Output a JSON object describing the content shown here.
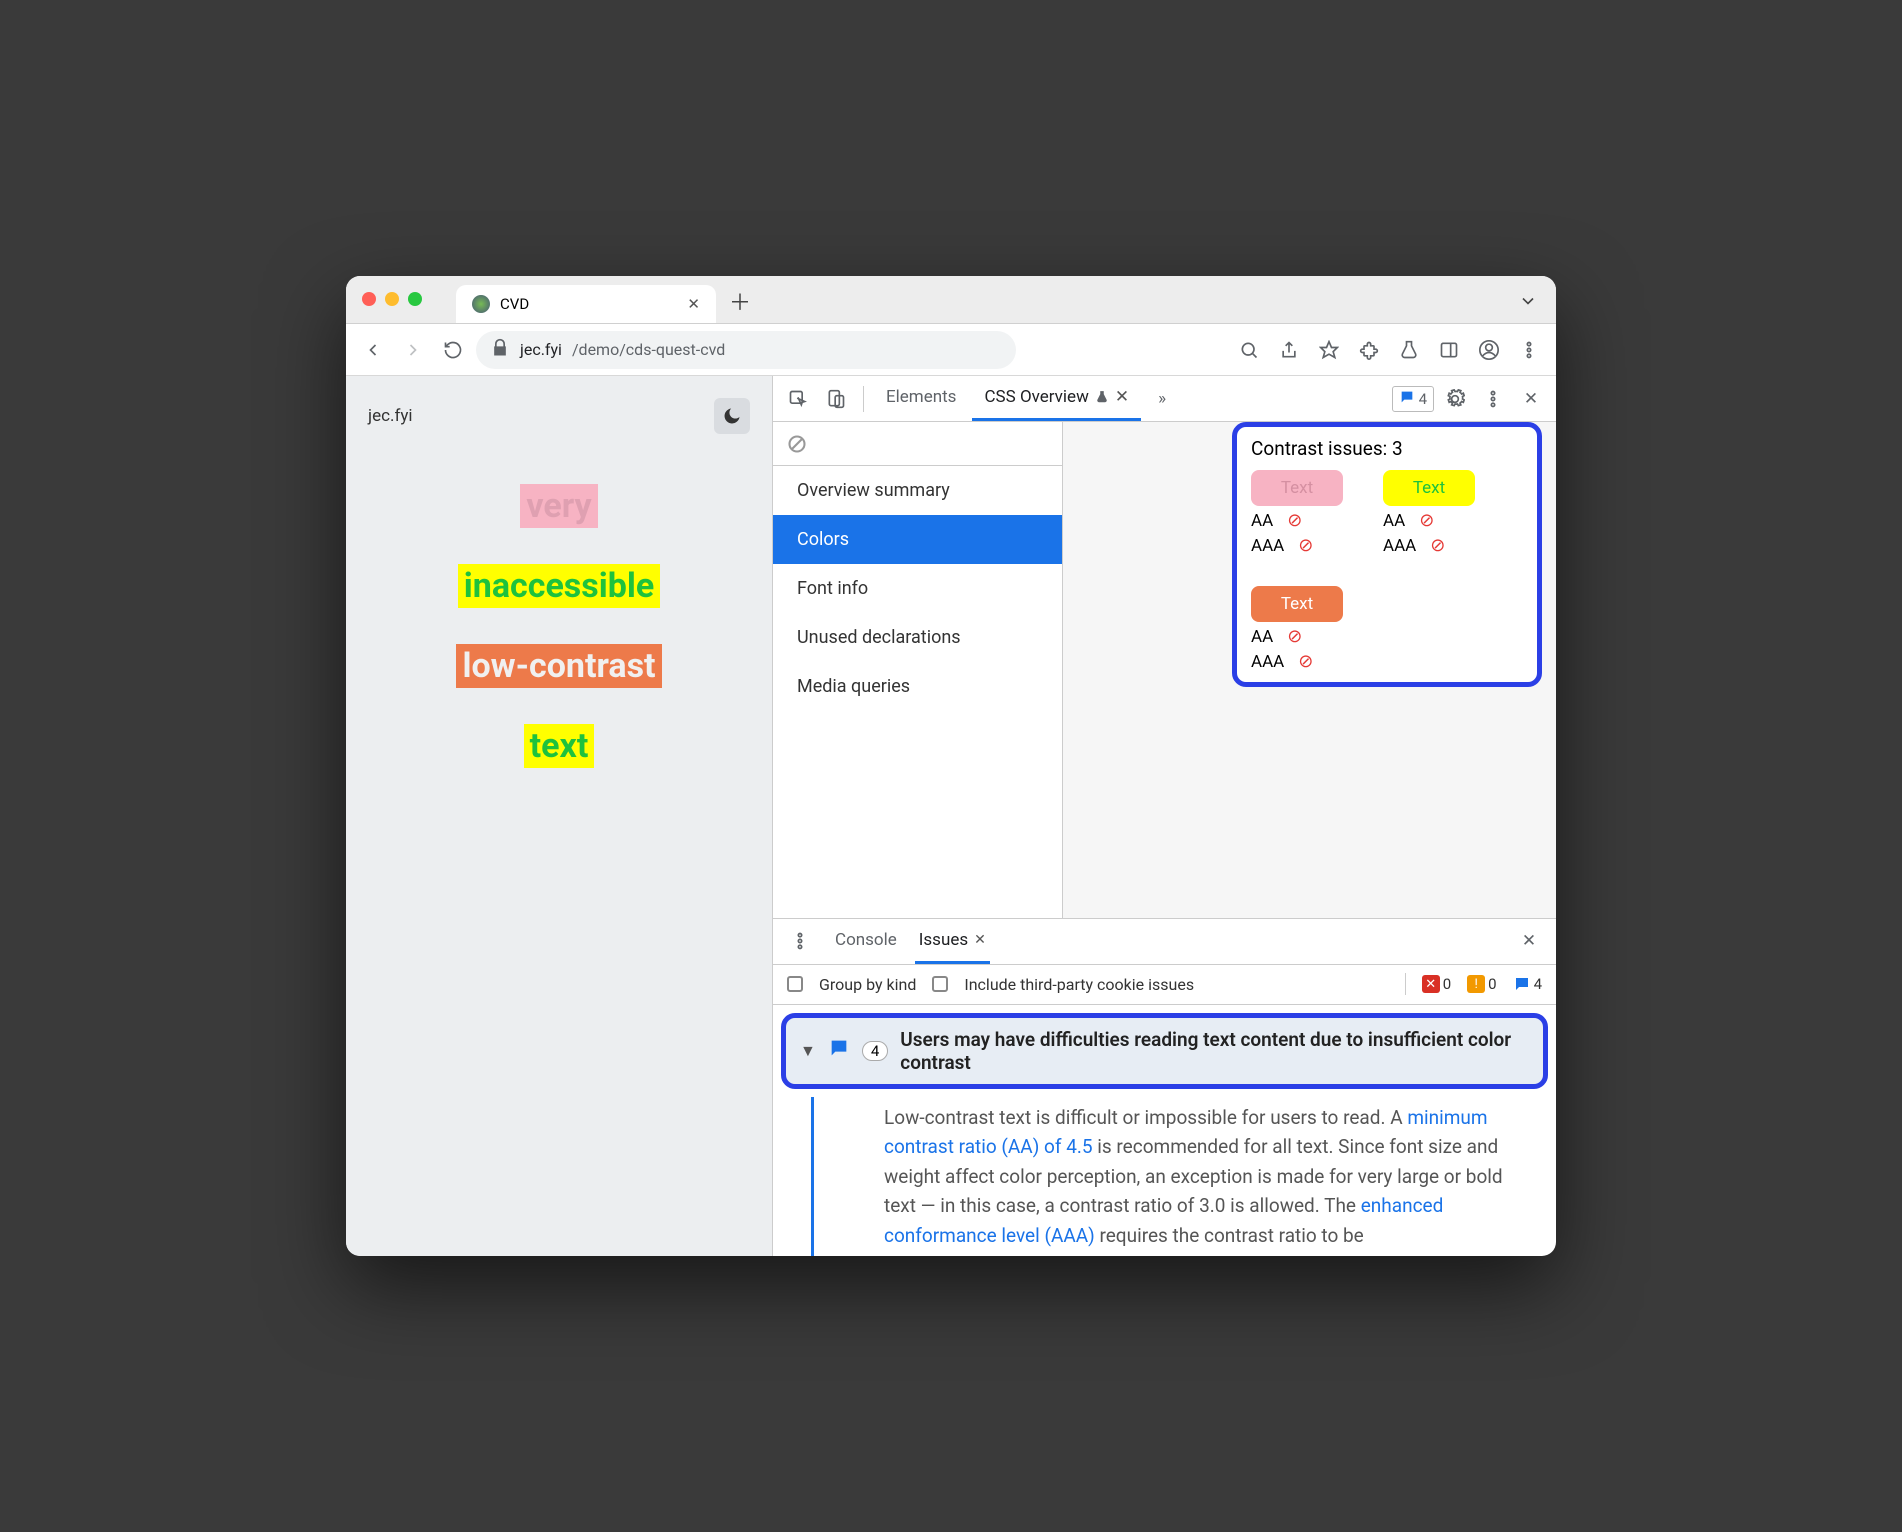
{
  "browser": {
    "tab_title": "CVD",
    "url_host": "jec.fyi",
    "url_path": "/demo/cds-quest-cvd"
  },
  "page": {
    "site_title": "jec.fyi",
    "samples": [
      "very",
      "inaccessible",
      "low-contrast",
      "text"
    ]
  },
  "devtools": {
    "tabs": {
      "elements": "Elements",
      "css_overview": "CSS Overview",
      "more_count": ""
    },
    "issues_badge": "4",
    "sidebar": {
      "items": [
        "Overview summary",
        "Colors",
        "Font info",
        "Unused declarations",
        "Media queries"
      ],
      "active_index": 1
    },
    "contrast": {
      "title": "Contrast issues: 3",
      "swatch_label": "Text",
      "aa": "AA",
      "aaa": "AAA"
    }
  },
  "drawer": {
    "tabs": {
      "console": "Console",
      "issues": "Issues"
    },
    "opts": {
      "group": "Group by kind",
      "third_party": "Include third-party cookie issues"
    },
    "counts": {
      "errors": "0",
      "warnings": "0",
      "issues": "4"
    },
    "issue": {
      "count": "4",
      "title": "Users may have difficulties reading text content due to insufficient color contrast",
      "body_pre": "Low-contrast text is difficult or impossible for users to read. A ",
      "link1": "minimum contrast ratio (AA) of 4.5",
      "body_mid": " is recommended for all text. Since font size and weight affect color perception, an exception is made for very large or bold text — in this case, a contrast ratio of 3.0 is allowed. The ",
      "link2": "enhanced conformance level (AAA)",
      "body_post": " requires the contrast ratio to be"
    }
  }
}
